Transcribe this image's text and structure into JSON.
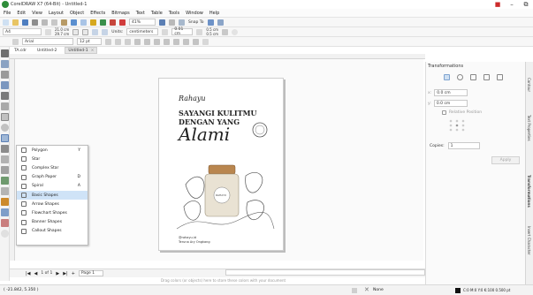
{
  "app": {
    "title": "CorelDRAW X7 (64-Bit) - Untitled-1"
  },
  "menu": [
    "File",
    "Edit",
    "View",
    "Layout",
    "Object",
    "Effects",
    "Bitmaps",
    "Text",
    "Table",
    "Tools",
    "Window",
    "Help"
  ],
  "toolbar1": {
    "zoom": "41%",
    "snap": "Snap To"
  },
  "toolbar2": {
    "page_size": "A4",
    "width": "21.0 cm",
    "height": "29.7 cm",
    "units_label": "Units:",
    "units": "centimeters",
    "nudge": "0.01 cm",
    "dup_x": "0.5 cm",
    "dup_y": "0.5 cm"
  },
  "toolbar3": {
    "font": "Arial",
    "size": "12 pt"
  },
  "tabs": [
    "TA.cdr",
    "Untitled-2",
    "Untitled-1"
  ],
  "popup": {
    "items": [
      {
        "label": "Polygon",
        "shortcut": "Y",
        "selected": false
      },
      {
        "label": "Star",
        "shortcut": "",
        "selected": false
      },
      {
        "label": "Complex Star",
        "shortcut": "",
        "selected": false
      },
      {
        "label": "Graph Paper",
        "shortcut": "D",
        "selected": false
      },
      {
        "label": "Spiral",
        "shortcut": "A",
        "selected": false
      },
      {
        "label": "Basic Shapes",
        "shortcut": "",
        "selected": true
      },
      {
        "label": "Arrow Shapes",
        "shortcut": "",
        "selected": false
      },
      {
        "label": "Flowchart Shapes",
        "shortcut": "",
        "selected": false
      },
      {
        "label": "Banner Shapes",
        "shortcut": "",
        "selected": false
      },
      {
        "label": "Callout Shapes",
        "shortcut": "",
        "selected": false
      }
    ]
  },
  "design": {
    "brand": "Rahayu",
    "line1": "SAYANGI KULITMU",
    "line2": "DENGAN YANG",
    "script": "Alami",
    "jar_label": "RAHAYU",
    "footer1": "@rahayu.id",
    "footer2": "Teruna Ary Ongkang"
  },
  "transform": {
    "title": "Transformations",
    "x": "0.0 cm",
    "y": "0.0 cm",
    "relative": "Relative Position",
    "copies_label": "Copies:",
    "copies": "1",
    "apply": "Apply"
  },
  "dock_tabs": [
    "Contour",
    "Text Properties",
    "Transformations",
    "Insert Character"
  ],
  "pager": {
    "info": "1 of 1",
    "page": "Page 1"
  },
  "hint": "Drag colors (or objects) here to store these colors with your document",
  "status": {
    "coords": "( -21.842, 5.350 )",
    "fill": "None",
    "color_info": "C:0 M:0 Y:0 K:100  0.500 pt"
  },
  "colors": {
    "accent": "#2f8d3a",
    "selection": "#cfe3f7"
  }
}
